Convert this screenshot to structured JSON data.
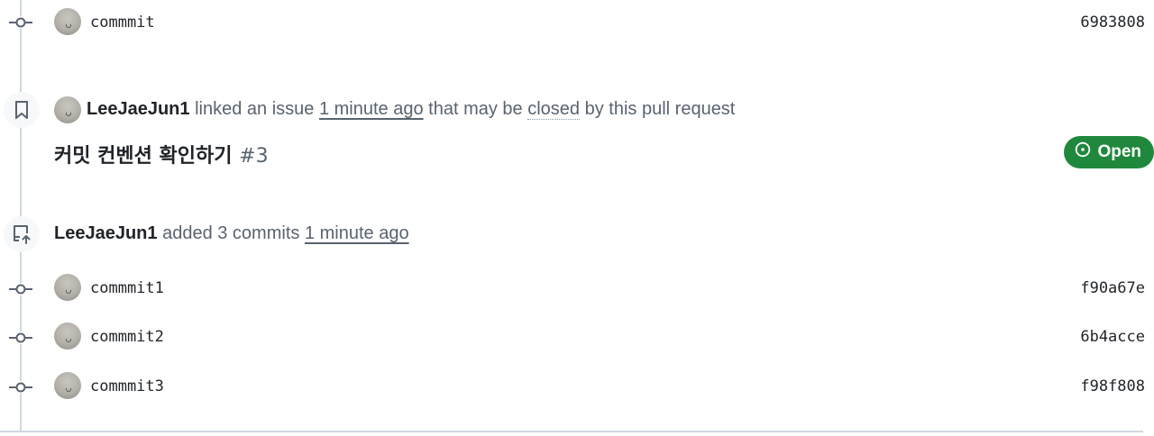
{
  "timeline": {
    "top_commit": {
      "message": "commmit",
      "sha": "6983808"
    },
    "linked_event": {
      "author": "LeeJaeJun1",
      "action_before": "linked an issue",
      "time": "1 minute ago",
      "action_after_1": "that may be",
      "closed_word": "closed",
      "action_after_2": "by this pull request"
    },
    "issue": {
      "title": "커밋 컨벤션 확인하기",
      "number": "#3",
      "state": "Open"
    },
    "push_event": {
      "author": "LeeJaeJun1",
      "action": "added 3 commits",
      "time": "1 minute ago"
    },
    "commits": [
      {
        "message": "commmit1",
        "sha": "f90a67e"
      },
      {
        "message": "commmit2",
        "sha": "6b4acce"
      },
      {
        "message": "commmit3",
        "sha": "f98f808"
      }
    ]
  },
  "colors": {
    "open_badge": "#1f883d",
    "muted_text": "#59636e",
    "timeline_line": "#d0d7de"
  }
}
